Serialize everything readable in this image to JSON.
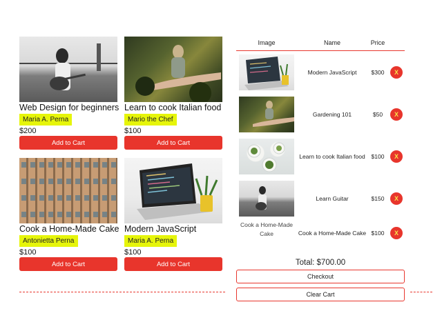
{
  "courses": [
    {
      "title": "Web Design for beginners",
      "author": "Maria A. Perna",
      "price": "$200",
      "button": "Add to Cart",
      "image": "woman-playing-guitar-photo"
    },
    {
      "title": "Learn to cook Italian food",
      "author": "Mario the Chef",
      "price": "$100",
      "button": "Add to Cart",
      "image": "woman-in-garden-photo"
    },
    {
      "title": "Cook a Home-Made Cake",
      "author": "Antonietta Perna",
      "price": "$100",
      "button": "Add to Cart",
      "image": "building-facade-photo"
    },
    {
      "title": "Modern JavaScript",
      "author": "Maria A. Perna",
      "price": "$100",
      "button": "Add to Cart",
      "image": "laptop-with-code-photo"
    }
  ],
  "cart": {
    "headers": {
      "image": "Image",
      "name": "Name",
      "price": "Price"
    },
    "items": [
      {
        "name": "Modern JavaScript",
        "price": "$300",
        "remove": "X",
        "image": "laptop-with-code-photo"
      },
      {
        "name": "Gardening 101",
        "price": "$50",
        "remove": "X",
        "image": "woman-in-garden-photo"
      },
      {
        "name": "Learn to cook Italian food",
        "price": "$100",
        "remove": "X",
        "image": "food-plates-photo"
      },
      {
        "name": "Learn Guitar",
        "price": "$150",
        "remove": "X",
        "image": "woman-playing-guitar-photo"
      },
      {
        "name": "Cook a Home-Made Cake",
        "price": "$100",
        "remove": "X",
        "image_alt": "Cook a Home-Made Cake"
      }
    ],
    "total": "Total: $700.00",
    "checkout": "Checkout",
    "clear": "Clear Cart"
  },
  "colors": {
    "accent": "#e8352c",
    "highlight": "#e6f50a",
    "x_text": "#f7e34a"
  }
}
